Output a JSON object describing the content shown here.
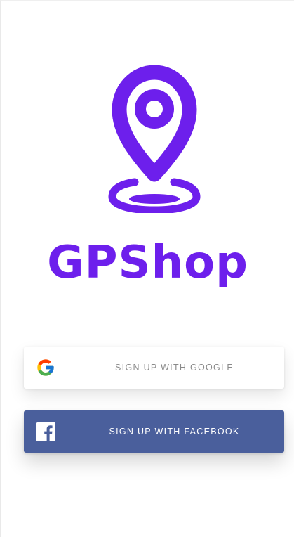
{
  "app": {
    "name": "GPShop",
    "brand_color": "#6d1fec",
    "logo_icon": "location-pin-icon"
  },
  "buttons": {
    "google": {
      "label": "SIGN UP WITH GOOGLE",
      "icon": "google-icon"
    },
    "facebook": {
      "label": "SIGN UP WITH FACEBOOK",
      "icon": "facebook-icon",
      "color": "#4a5f9c"
    }
  }
}
